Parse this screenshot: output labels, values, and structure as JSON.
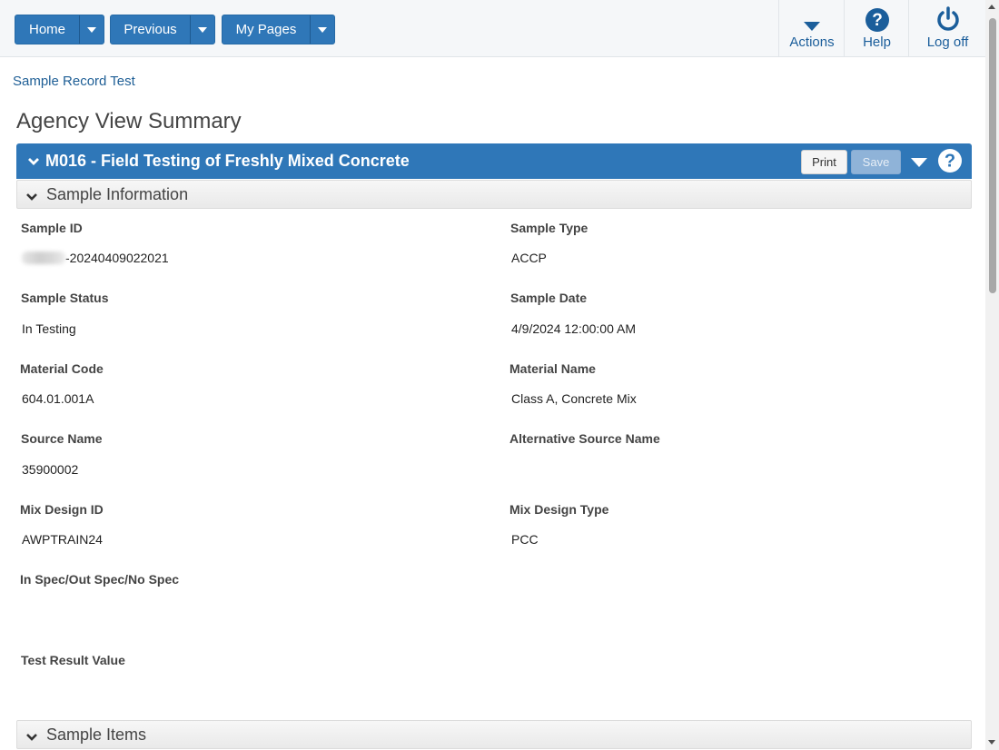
{
  "nav": {
    "home": "Home",
    "previous": "Previous",
    "my_pages": "My Pages"
  },
  "tools": {
    "actions": "Actions",
    "help": "Help",
    "logoff": "Log off"
  },
  "breadcrumb": "Sample Record Test",
  "page_title": "Agency View Summary",
  "panel": {
    "title": "M016 - Field Testing of Freshly Mixed Concrete",
    "print_label": "Print",
    "save_label": "Save"
  },
  "sections": {
    "sample_information": "Sample Information",
    "sample_items": "Sample Items"
  },
  "fields": {
    "sample_id": {
      "label": "Sample ID",
      "value": "-20240409022021"
    },
    "sample_type": {
      "label": "Sample Type",
      "value": "ACCP"
    },
    "sample_status": {
      "label": "Sample Status",
      "value": "In Testing"
    },
    "sample_date": {
      "label": "Sample Date",
      "value": "4/9/2024 12:00:00 AM"
    },
    "material_code": {
      "label": "Material Code",
      "value": "604.01.001A"
    },
    "material_name": {
      "label": "Material Name",
      "value": "Class A, Concrete Mix"
    },
    "source_name": {
      "label": "Source Name",
      "value": "35900002"
    },
    "alt_source_name": {
      "label": "Alternative Source Name",
      "value": ""
    },
    "mix_design_id": {
      "label": "Mix Design ID",
      "value": "AWPTRAIN24"
    },
    "mix_design_type": {
      "label": "Mix Design Type",
      "value": "PCC"
    },
    "spec": {
      "label": "In Spec/Out Spec/No Spec",
      "value": ""
    },
    "test_result_value": {
      "label": "Test Result Value",
      "value": ""
    }
  },
  "colors": {
    "primary": "#2f77b8",
    "link": "#1f5f96"
  }
}
